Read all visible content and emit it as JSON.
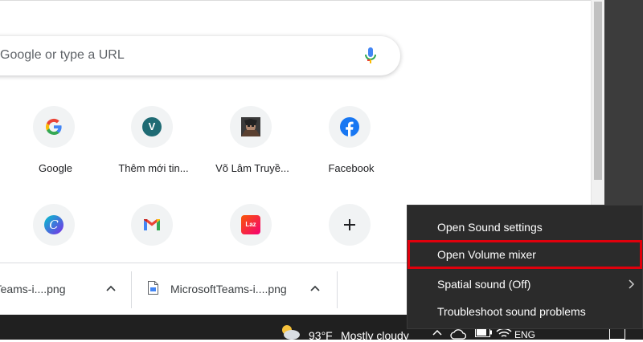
{
  "search": {
    "placeholder": "Google or type a URL"
  },
  "shortcuts": [
    {
      "label": "Google",
      "icon": "google-icon"
    },
    {
      "label": "Thêm mới tin...",
      "icon": "v-letter-icon",
      "letter": "V"
    },
    {
      "label": "Võ Lâm Truyề...",
      "icon": "game-avatar-icon"
    },
    {
      "label": "Facebook",
      "icon": "facebook-icon"
    },
    {
      "label": "",
      "icon": "canva-icon",
      "letter": "C"
    },
    {
      "label": "",
      "icon": "gmail-icon"
    },
    {
      "label": "",
      "icon": "lazada-icon",
      "letter": "Laz"
    },
    {
      "label": "",
      "icon": "add-shortcut-icon"
    }
  ],
  "downloads": [
    {
      "name": "oftTeams-i....png"
    },
    {
      "name": "MicrosoftTeams-i....png"
    }
  ],
  "context_menu": {
    "items": [
      {
        "label": "Open Sound settings"
      },
      {
        "label": "Open Volume mixer",
        "highlighted": true
      },
      {
        "label": "Spatial sound (Off)",
        "has_submenu": true
      },
      {
        "label": "Troubleshoot sound problems"
      }
    ]
  },
  "taskbar": {
    "temperature": "93°F",
    "weather": "Mostly cloudy",
    "language": "ENG"
  },
  "colors": {
    "highlight_border": "#e0000c",
    "menu_bg": "#2b2b2b",
    "taskbar_bg": "#202020"
  }
}
